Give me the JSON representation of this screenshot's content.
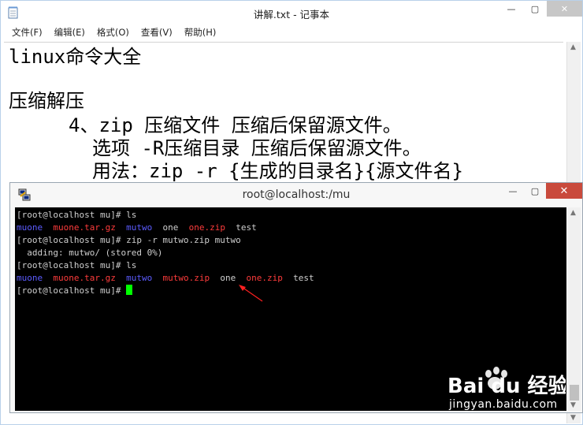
{
  "notepad": {
    "title": "讲解.txt - 记事本",
    "menu": [
      "文件(F)",
      "编辑(E)",
      "格式(O)",
      "查看(V)",
      "帮助(H)"
    ],
    "lines": [
      "linux命令大全",
      "压缩解压",
      "4、zip 压缩文件 压缩后保留源文件。",
      "选项 -R压缩目录 压缩后保留源文件。",
      "用法：zip -r {生成的目录名}{源文件名}"
    ]
  },
  "terminal": {
    "title": "root@localhost:/mu",
    "prompt": "[root@localhost mu]#",
    "cmd1": " ls",
    "ls1": [
      "muone",
      "muone.tar.gz",
      "mutwo",
      "one",
      "one.zip",
      "test"
    ],
    "cmd2": " zip -r mutwo.zip mutwo",
    "adding": "  adding: mutwo/ (stored 0%)",
    "cmd3": " ls",
    "ls2": [
      "muone",
      "muone.tar.gz",
      "mutwo",
      "mutwo.zip",
      "one",
      "one.zip",
      "test"
    ]
  },
  "watermark": {
    "brand": "Bai du 经验",
    "url": "jingyan.baidu.com"
  },
  "colors": {
    "dir_blue": "#5c5cff",
    "archive_red": "#ff3c3c",
    "cursor_green": "#00ff00",
    "close_red": "#c94a3c"
  }
}
